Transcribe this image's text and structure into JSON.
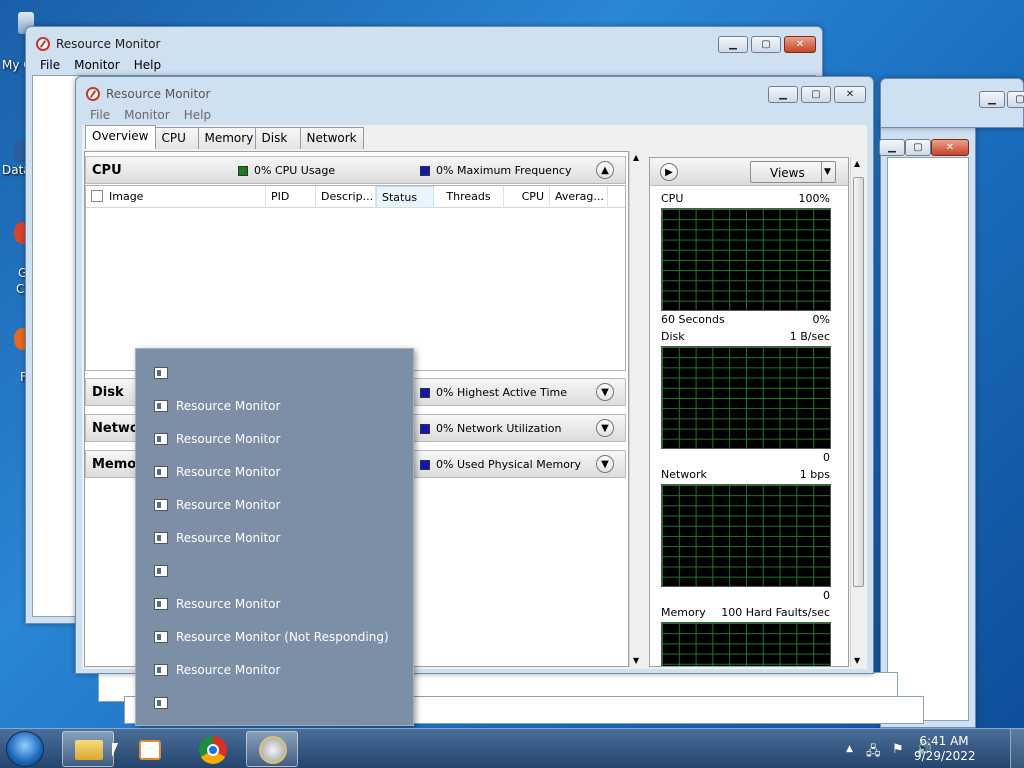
{
  "desktop": {
    "labels": [
      "My C",
      "Data",
      "G",
      "C",
      "F"
    ]
  },
  "back_window": {
    "title": "Resource Monitor",
    "menu": [
      "File",
      "Monitor",
      "Help"
    ]
  },
  "main_window": {
    "title": "Resource Monitor",
    "menu": [
      "File",
      "Monitor",
      "Help"
    ],
    "tabs": [
      "Overview",
      "CPU",
      "Memory",
      "Disk",
      "Network"
    ],
    "cpu_section": {
      "name": "CPU",
      "usage": "0% CPU Usage",
      "frequency": "0% Maximum Frequency",
      "columns": [
        "Image",
        "PID",
        "Descrip...",
        "Status",
        "Threads",
        "CPU",
        "Averag..."
      ]
    },
    "disk_section": {
      "name": "Disk",
      "legend": "0% Highest Active Time"
    },
    "network_section": {
      "name": "Networ",
      "legend": "0% Network Utilization"
    },
    "memory_section": {
      "name": "Memor",
      "legend": "0% Used Physical Memory"
    },
    "views_label": "Views",
    "graphs": {
      "cpu": {
        "label": "CPU",
        "max": "100%",
        "bottom_left": "60 Seconds",
        "bottom_right": "0%"
      },
      "disk": {
        "label": "Disk",
        "max": "1 B/sec",
        "bottom_right": "0"
      },
      "network": {
        "label": "Network",
        "max": "1 bps",
        "bottom_right": "0"
      },
      "memory": {
        "label": "Memory",
        "max": "100 Hard Faults/sec"
      }
    }
  },
  "jump_list": {
    "items": [
      "",
      "Resource Monitor",
      "Resource Monitor",
      "Resource Monitor",
      "Resource Monitor",
      "Resource Monitor",
      "",
      "Resource Monitor",
      "Resource Monitor (Not Responding)",
      "Resource Monitor",
      ""
    ]
  },
  "taskbar": {
    "time": "6:41 AM",
    "date": "9/29/2022"
  },
  "colors": {
    "graph_grid": "#1a7a2a",
    "cpu_usage_swatch": "#1f7a1f",
    "frequency_swatch": "#1414b4",
    "popup_bg": "#7c8fa6"
  }
}
